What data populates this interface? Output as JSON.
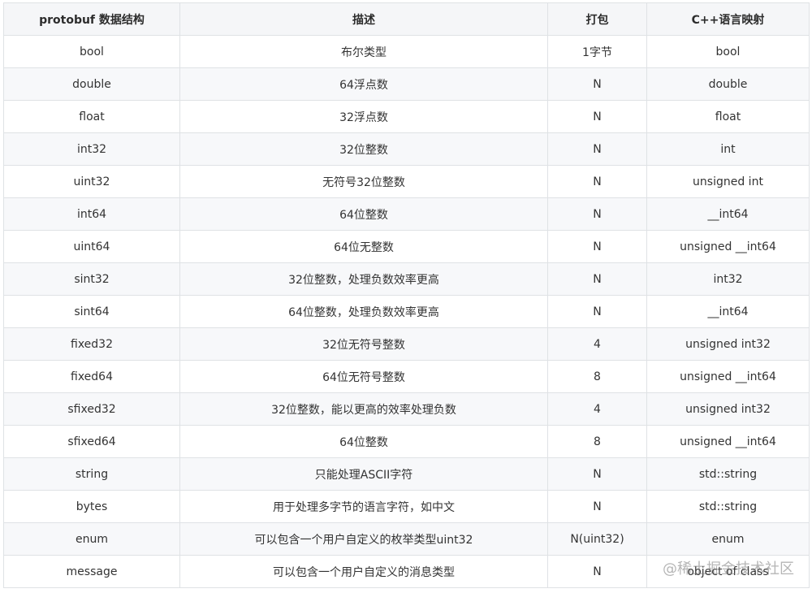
{
  "table": {
    "headers": [
      "protobuf 数据结构",
      "描述",
      "打包",
      "C++语言映射"
    ],
    "rows": [
      [
        "bool",
        "布尔类型",
        "1字节",
        "bool"
      ],
      [
        "double",
        "64浮点数",
        "N",
        "double"
      ],
      [
        "float",
        "32浮点数",
        "N",
        "float"
      ],
      [
        "int32",
        "32位整数",
        "N",
        "int"
      ],
      [
        "uint32",
        "无符号32位整数",
        "N",
        "unsigned int"
      ],
      [
        "int64",
        "64位整数",
        "N",
        "__int64"
      ],
      [
        "uint64",
        "64位无整数",
        "N",
        "unsigned __int64"
      ],
      [
        "sint32",
        "32位整数，处理负数效率更高",
        "N",
        "int32"
      ],
      [
        "sint64",
        "64位整数，处理负数效率更高",
        "N",
        "__int64"
      ],
      [
        "fixed32",
        "32位无符号整数",
        "4",
        "unsigned int32"
      ],
      [
        "fixed64",
        "64位无符号整数",
        "8",
        "unsigned __int64"
      ],
      [
        "sfixed32",
        "32位整数，能以更高的效率处理负数",
        "4",
        "unsigned int32"
      ],
      [
        "sfixed64",
        "64位整数",
        "8",
        "unsigned __int64"
      ],
      [
        "string",
        "只能处理ASCII字符",
        "N",
        "std::string"
      ],
      [
        "bytes",
        "用于处理多字节的语言字符，如中文",
        "N",
        "std::string"
      ],
      [
        "enum",
        "可以包含一个用户自定义的枚举类型uint32",
        "N(uint32)",
        "enum"
      ],
      [
        "message",
        "可以包含一个用户自定义的消息类型",
        "N",
        "object of class"
      ]
    ]
  },
  "watermark": "@稀土掘金技术社区"
}
